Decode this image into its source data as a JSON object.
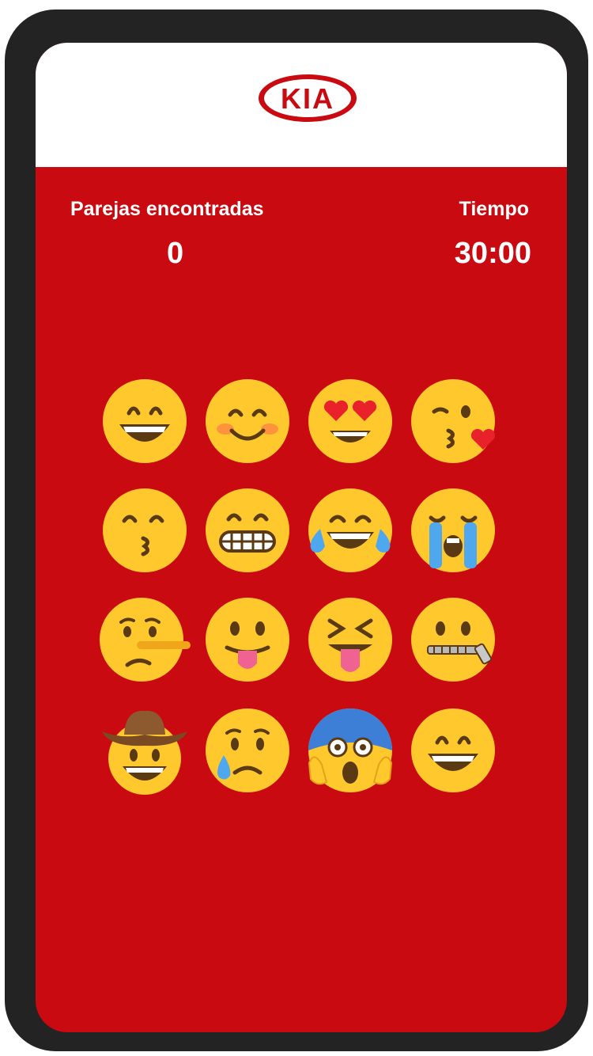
{
  "brand": {
    "logo_text": "KIA",
    "primary_color": "#c90a10"
  },
  "score": {
    "label": "Parejas encontradas",
    "value": "0"
  },
  "timer": {
    "label": "Tiempo",
    "value": "30:00"
  },
  "cards": [
    {
      "icon": "grinning-face-icon"
    },
    {
      "icon": "smiling-face-blush-icon"
    },
    {
      "icon": "heart-eyes-face-icon"
    },
    {
      "icon": "face-blowing-kiss-icon"
    },
    {
      "icon": "kissing-face-smiling-eyes-icon"
    },
    {
      "icon": "grimacing-face-icon"
    },
    {
      "icon": "tears-of-joy-face-icon"
    },
    {
      "icon": "loudly-crying-face-icon"
    },
    {
      "icon": "lying-face-icon"
    },
    {
      "icon": "face-with-tongue-icon"
    },
    {
      "icon": "squinting-tongue-face-icon"
    },
    {
      "icon": "zipper-mouth-face-icon"
    },
    {
      "icon": "cowboy-hat-face-icon"
    },
    {
      "icon": "crying-face-icon"
    },
    {
      "icon": "screaming-in-fear-face-icon"
    },
    {
      "icon": "grinning-face-icon"
    }
  ]
}
